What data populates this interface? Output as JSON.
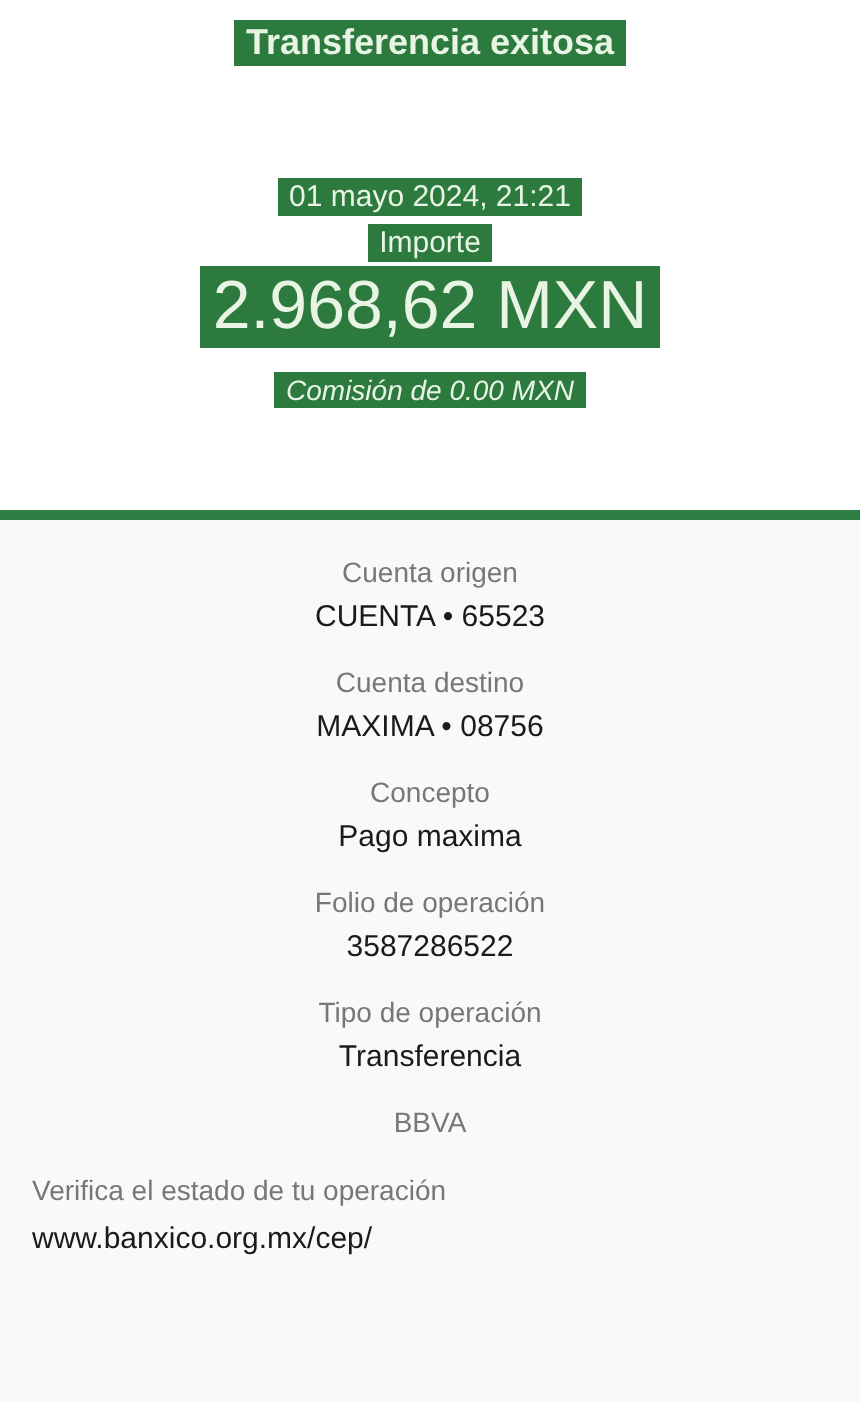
{
  "header": {
    "title": "Transferencia exitosa",
    "date": "01 mayo 2024, 21:21",
    "amount_label": "Importe",
    "amount": "2.968,62 MXN",
    "fee": "Comisión de 0.00 MXN"
  },
  "details": [
    {
      "label": "Cuenta origen",
      "value": "CUENTA • 65523"
    },
    {
      "label": "Cuenta destino",
      "value": "MAXIMA • 08756"
    },
    {
      "label": "Concepto",
      "value": "Pago maxima"
    },
    {
      "label": "Folio de operación",
      "value": "3587286522"
    },
    {
      "label": "Tipo de operación",
      "value": "Transferencia"
    }
  ],
  "bank": "BBVA",
  "verify": {
    "text": "Verifica el estado de tu operación",
    "link": "www.banxico.org.mx/cep/"
  }
}
